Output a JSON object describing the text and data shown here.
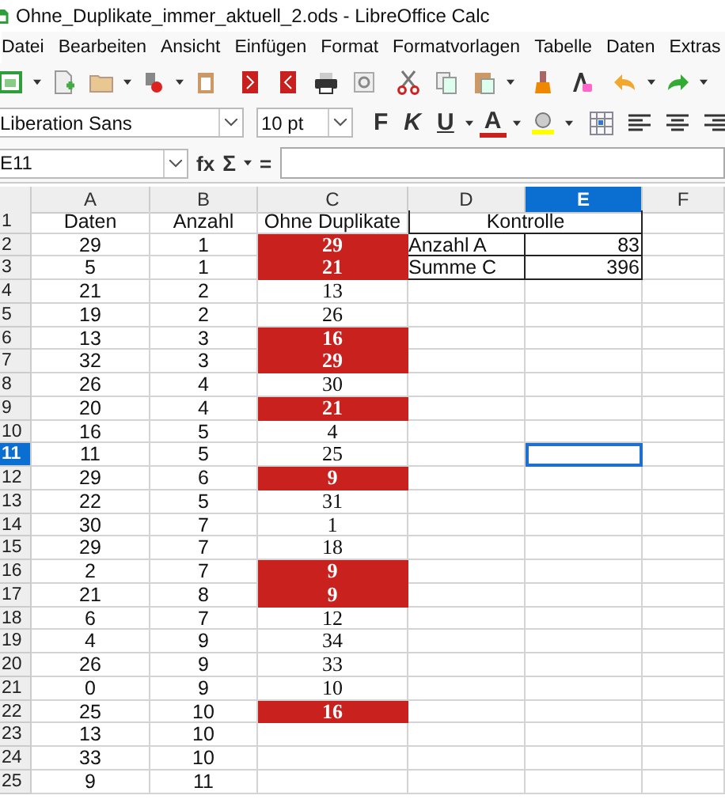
{
  "window": {
    "title": "Ohne_Duplikate_immer_aktuell_2.ods - LibreOffice Calc"
  },
  "menu": [
    "Datei",
    "Bearbeiten",
    "Ansicht",
    "Einfügen",
    "Format",
    "Formatvorlagen",
    "Tabelle",
    "Daten",
    "Extras"
  ],
  "format_bar": {
    "font_name": "Liberation Sans",
    "font_size": "10 pt",
    "bold_label": "F",
    "italic_label": "K",
    "underline_label": "U",
    "font_color_label": "A"
  },
  "formula_bar": {
    "name_box": "E11",
    "function_label": "fx",
    "sum_label": "Σ",
    "equals_label": "="
  },
  "columns": [
    {
      "label": "A",
      "selected": false
    },
    {
      "label": "B",
      "selected": false
    },
    {
      "label": "C",
      "selected": false
    },
    {
      "label": "D",
      "selected": false
    },
    {
      "label": "E",
      "selected": true
    },
    {
      "label": "F",
      "selected": false
    }
  ],
  "header_row": {
    "number": "1",
    "selected": false,
    "a": "Daten",
    "b": "Anzahl",
    "c": "Ohne Duplikate",
    "kontrolle": "Kontrolle"
  },
  "kontrolle": [
    {
      "label": "Anzahl A",
      "value": "83"
    },
    {
      "label": "Summe C",
      "value": "396"
    }
  ],
  "rows": [
    {
      "number": "2",
      "selected": false,
      "a": "29",
      "b": "1",
      "c": "29",
      "duplicate": true
    },
    {
      "number": "3",
      "selected": false,
      "a": "5",
      "b": "1",
      "c": "21",
      "duplicate": true
    },
    {
      "number": "4",
      "selected": false,
      "a": "21",
      "b": "2",
      "c": "13",
      "duplicate": false
    },
    {
      "number": "5",
      "selected": false,
      "a": "19",
      "b": "2",
      "c": "26",
      "duplicate": false
    },
    {
      "number": "6",
      "selected": false,
      "a": "13",
      "b": "3",
      "c": "16",
      "duplicate": true
    },
    {
      "number": "7",
      "selected": false,
      "a": "32",
      "b": "3",
      "c": "29",
      "duplicate": true
    },
    {
      "number": "8",
      "selected": false,
      "a": "26",
      "b": "4",
      "c": "30",
      "duplicate": false
    },
    {
      "number": "9",
      "selected": false,
      "a": "20",
      "b": "4",
      "c": "21",
      "duplicate": true
    },
    {
      "number": "10",
      "selected": false,
      "a": "16",
      "b": "5",
      "c": "4",
      "duplicate": false
    },
    {
      "number": "11",
      "selected": true,
      "a": "11",
      "b": "5",
      "c": "25",
      "duplicate": false
    },
    {
      "number": "12",
      "selected": false,
      "a": "29",
      "b": "6",
      "c": "9",
      "duplicate": true
    },
    {
      "number": "13",
      "selected": false,
      "a": "22",
      "b": "5",
      "c": "31",
      "duplicate": false
    },
    {
      "number": "14",
      "selected": false,
      "a": "30",
      "b": "7",
      "c": "1",
      "duplicate": false
    },
    {
      "number": "15",
      "selected": false,
      "a": "29",
      "b": "7",
      "c": "18",
      "duplicate": false
    },
    {
      "number": "16",
      "selected": false,
      "a": "2",
      "b": "7",
      "c": "9",
      "duplicate": true
    },
    {
      "number": "17",
      "selected": false,
      "a": "21",
      "b": "8",
      "c": "9",
      "duplicate": true
    },
    {
      "number": "18",
      "selected": false,
      "a": "6",
      "b": "7",
      "c": "12",
      "duplicate": false
    },
    {
      "number": "19",
      "selected": false,
      "a": "4",
      "b": "9",
      "c": "34",
      "duplicate": false
    },
    {
      "number": "20",
      "selected": false,
      "a": "26",
      "b": "9",
      "c": "33",
      "duplicate": false
    },
    {
      "number": "21",
      "selected": false,
      "a": "0",
      "b": "9",
      "c": "10",
      "duplicate": false
    },
    {
      "number": "22",
      "selected": false,
      "a": "25",
      "b": "10",
      "c": "16",
      "duplicate": true
    },
    {
      "number": "23",
      "selected": false,
      "a": "13",
      "b": "10"
    },
    {
      "number": "24",
      "selected": false,
      "a": "33",
      "b": "10"
    },
    {
      "number": "25",
      "selected": false,
      "a": "9",
      "b": "11"
    }
  ]
}
